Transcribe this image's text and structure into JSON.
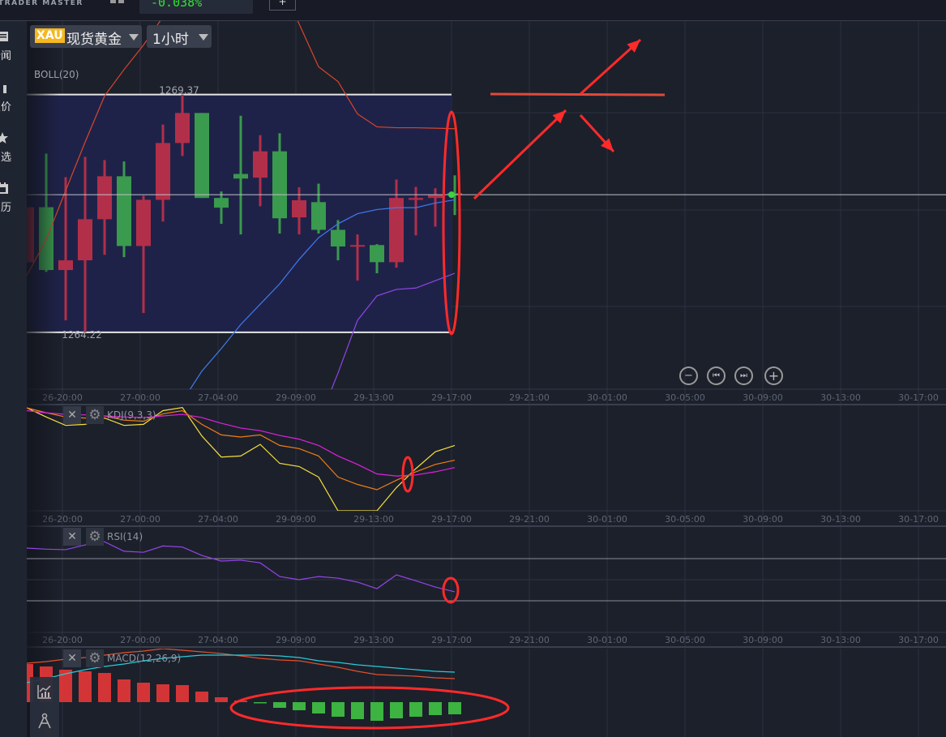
{
  "header": {
    "logo_text": "TRADER MASTER",
    "change_percent": "-0.038%",
    "add_button": "+"
  },
  "sidebar": {
    "items": [
      {
        "label": "新闻",
        "icon": "news-icon"
      },
      {
        "label": "报价",
        "icon": "quotes-icon"
      },
      {
        "label": "自选",
        "icon": "star-icon"
      },
      {
        "label": "日历",
        "icon": "calendar-icon"
      }
    ]
  },
  "toolbar": {
    "symbol_code": "XAU",
    "symbol_name": "现货黄金",
    "period": "1小时"
  },
  "main_chart": {
    "indicator": "BOLL(20)",
    "high_label": "1269.37",
    "low_label": "1264.22"
  },
  "nav_buttons": {
    "zoom_out": "−",
    "prev": "⏮",
    "next": "⏭",
    "zoom_in": "+"
  },
  "indicators": {
    "kdj": "KDJ(9,3,3)",
    "rsi": "RSI(14)",
    "macd": "MACD(12,26,9)",
    "close": "✕",
    "settings": "⚙"
  },
  "time_axis": [
    "26-20:00",
    "27-00:00",
    "27-04:00",
    "29-09:00",
    "29-13:00",
    "29-17:00",
    "29-21:00",
    "30-01:00",
    "30-05:00",
    "30-09:00",
    "30-13:00",
    "30-17:00"
  ],
  "colors": {
    "up": "#b22f4a",
    "down": "#3a9a4e",
    "macd_up": "#d33536",
    "macd_down": "#3db341",
    "annotation": "#ff2a2a",
    "boll_upper": "#d9452c",
    "boll_mid": "#3f7bf0",
    "boll_lower": "#8f45e8",
    "k": "#f5e03c",
    "d": "#f07d14",
    "j": "#e020e0",
    "rsi": "#9445e8",
    "dif": "#27cbd6",
    "dea": "#e0502c"
  },
  "chart_data": [
    {
      "type": "candlestick",
      "title": "BOLL(20)",
      "ylim": [
        1262.99,
        1270.96
      ],
      "current_price": 1267.2,
      "candles": [
        [
          1265.74,
          1266.93,
          1265.74,
          1266.93
        ],
        [
          1266.93,
          1268.09,
          1265.53,
          1265.57
        ],
        [
          1265.57,
          1267.58,
          1264.48,
          1265.78
        ],
        [
          1265.78,
          1268.02,
          1264.22,
          1266.67
        ],
        [
          1266.67,
          1267.95,
          1265.9,
          1267.6
        ],
        [
          1267.6,
          1267.92,
          1265.85,
          1266.09
        ],
        [
          1266.09,
          1267.18,
          1264.64,
          1267.09
        ],
        [
          1267.09,
          1268.72,
          1266.62,
          1268.32
        ],
        [
          1268.32,
          1269.37,
          1268.04,
          1268.97
        ],
        [
          1268.97,
          1268.97,
          1267.13,
          1267.13
        ],
        [
          1267.13,
          1267.27,
          1266.57,
          1266.92
        ],
        [
          1267.65,
          1268.91,
          1266.34,
          1267.55
        ],
        [
          1267.57,
          1268.49,
          1266.95,
          1268.14
        ],
        [
          1268.14,
          1268.53,
          1266.36,
          1266.69
        ],
        [
          1266.71,
          1267.36,
          1266.34,
          1267.08
        ],
        [
          1267.04,
          1267.44,
          1266.36,
          1266.44
        ],
        [
          1266.44,
          1266.65,
          1265.78,
          1266.08
        ],
        [
          1266.09,
          1266.34,
          1265.34,
          1266.11
        ],
        [
          1266.11,
          1266.13,
          1265.5,
          1265.74
        ],
        [
          1265.74,
          1267.53,
          1265.62,
          1267.13
        ],
        [
          1267.09,
          1267.37,
          1266.32,
          1267.13
        ],
        [
          1267.13,
          1267.34,
          1266.51,
          1267.2
        ],
        [
          1267.23,
          1267.62,
          1266.76,
          1267.2
        ]
      ],
      "candle_format": "open,high,low,close",
      "boll_upper": [
        1265.45,
        1266.23,
        1267.29,
        1268.34,
        1269.34,
        1269.91,
        1270.44,
        1271.05,
        1271.5,
        1271.9,
        1272.1,
        1272.2,
        1272.1,
        1271.8,
        1270.9,
        1269.97,
        1269.65,
        1268.95,
        1268.67,
        1268.65,
        1268.65,
        1268.64,
        1268.63
      ],
      "boll_mid": [
        null,
        null,
        null,
        null,
        null,
        null,
        null,
        1262.12,
        1262.73,
        1263.38,
        1263.87,
        1264.39,
        1264.83,
        1265.27,
        1265.8,
        1266.27,
        1266.57,
        1266.79,
        1266.88,
        1266.92,
        1266.92,
        1267.02,
        1267.09
      ],
      "boll_lower": [
        null,
        null,
        null,
        null,
        null,
        null,
        null,
        null,
        null,
        null,
        null,
        null,
        null,
        null,
        null,
        1262.29,
        1263.34,
        1264.48,
        1265.01,
        1265.15,
        1265.18,
        1265.34,
        1265.5
      ]
    },
    {
      "type": "line",
      "title": "KDJ(9,3,3)",
      "ylim": [
        0,
        100
      ],
      "series": [
        {
          "name": "K",
          "values": [
            97.7,
            89,
            81,
            82,
            88,
            81,
            82,
            95,
            98,
            71,
            51,
            52,
            63,
            45,
            42,
            32,
            -2,
            -2,
            -2,
            22,
            40,
            56,
            62
          ]
        },
        {
          "name": "D",
          "values": [
            97.7,
            93,
            89,
            88,
            90,
            86,
            85,
            92,
            95,
            82,
            72,
            70,
            72,
            62,
            59,
            52,
            32,
            25,
            20,
            29,
            37,
            44,
            48
          ]
        },
        {
          "name": "J",
          "values": [
            95,
            93,
            91.5,
            91,
            90,
            89,
            88.5,
            90,
            91.5,
            88.5,
            83,
            78.5,
            76,
            71.5,
            68,
            62,
            52,
            44,
            35,
            33,
            34,
            37,
            41
          ]
        }
      ]
    },
    {
      "type": "line",
      "title": "RSI(14)",
      "ylim": [
        0,
        100
      ],
      "reference_lines": [
        70,
        30
      ],
      "series": [
        {
          "name": "RSI",
          "values": [
            80,
            79,
            78.5,
            83,
            86,
            77,
            76,
            82,
            81,
            73,
            67.7,
            68.5,
            66,
            53,
            50,
            53,
            51.5,
            47.7,
            41.5,
            54.6,
            49,
            43,
            38.5
          ]
        }
      ]
    },
    {
      "type": "bar",
      "title": "MACD(12,26,9)",
      "ylim": [
        -0.43,
        0.66
      ],
      "histogram": [
        0.47,
        0.44,
        0.4,
        0.38,
        0.36,
        0.28,
        0.24,
        0.22,
        0.21,
        0.13,
        0.06,
        0.02,
        -0.01,
        -0.07,
        -0.1,
        -0.14,
        -0.18,
        -0.21,
        -0.23,
        -0.2,
        -0.18,
        -0.16,
        -0.15
      ],
      "series": [
        {
          "name": "DEA",
          "values": [
            0.48,
            0.5,
            0.53,
            0.55,
            0.58,
            0.61,
            0.63,
            0.66,
            0.64,
            0.62,
            0.6,
            0.57,
            0.54,
            0.52,
            0.51,
            0.47,
            0.43,
            0.38,
            0.34,
            0.33,
            0.32,
            0.3,
            0.29
          ]
        },
        {
          "name": "DIF",
          "values": [
            0.24,
            0.29,
            0.35,
            0.4,
            0.44,
            0.47,
            0.51,
            0.54,
            0.56,
            0.58,
            0.58,
            0.58,
            0.58,
            0.57,
            0.55,
            0.51,
            0.49,
            0.46,
            0.44,
            0.42,
            0.4,
            0.38,
            0.37
          ]
        }
      ]
    }
  ]
}
